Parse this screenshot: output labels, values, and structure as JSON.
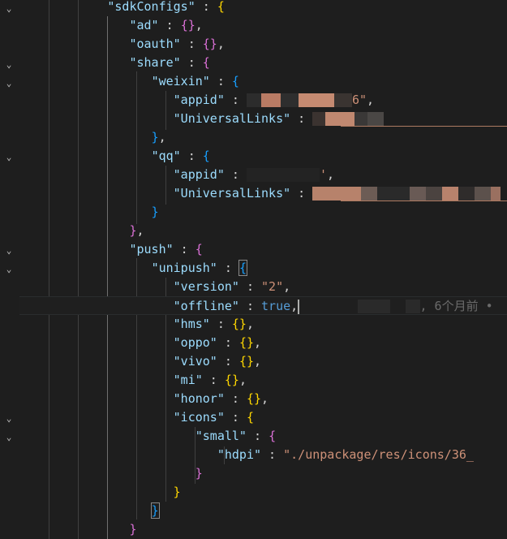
{
  "code": {
    "sdkConfigs": "\"sdkConfigs\"",
    "ad": "\"ad\"",
    "oauth": "\"oauth\"",
    "share": "\"share\"",
    "weixin": "\"weixin\"",
    "appid": "\"appid\"",
    "universal_links": "\"UniversalLinks\"",
    "qq": "\"qq\"",
    "push": "\"push\"",
    "unipush": "\"unipush\"",
    "version": "\"version\"",
    "version_value": "\"2\"",
    "offline": "\"offline\"",
    "offline_value": "true",
    "hms": "\"hms\"",
    "oppo": "\"oppo\"",
    "vivo": "\"vivo\"",
    "mi": "\"mi\"",
    "honor": "\"honor\"",
    "icons": "\"icons\"",
    "small": "\"small\"",
    "hdpi": "\"hdpi\"",
    "hdpi_value": "\"./unpackage/res/icons/36_",
    "weixin_appid_tail": "6\"",
    "qq_appid_tail": "'"
  },
  "blame": {
    "text": ", 6个月前 •"
  },
  "colors": {
    "background": "#1e1e1e",
    "key": "#9cdcfe",
    "string": "#ce9178",
    "brace_gold": "#ffd700",
    "brace_purple": "#da70d6",
    "brace_blue": "#179fff",
    "keyword": "#569cd6"
  },
  "icons": {
    "fold": "chevron-down-icon"
  }
}
